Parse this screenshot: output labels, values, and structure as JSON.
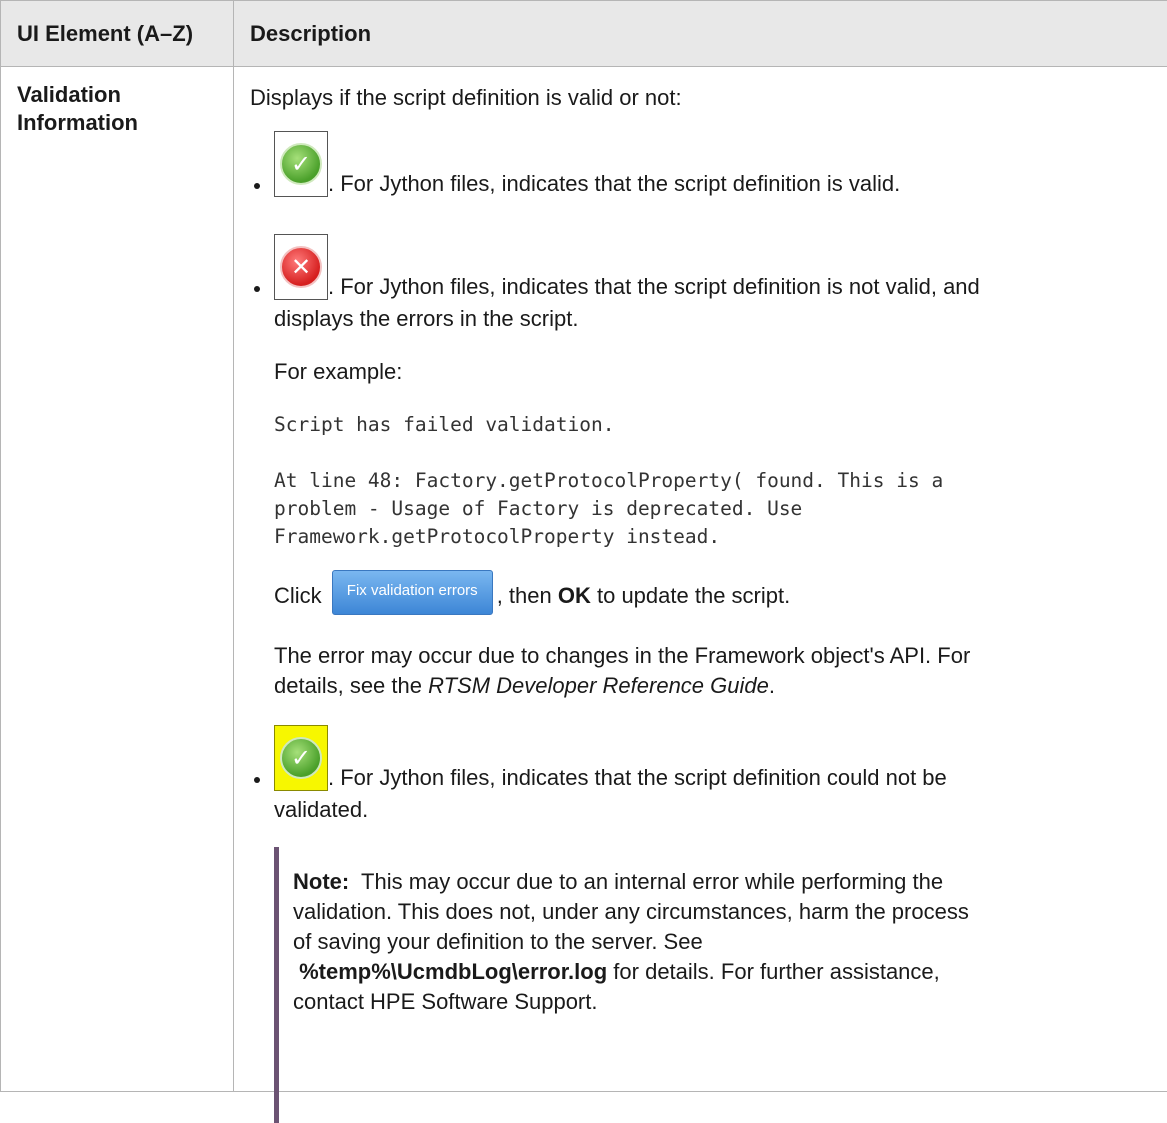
{
  "table": {
    "header": {
      "col1": "UI Element (A–Z)",
      "col2": "Description"
    },
    "row": {
      "element_line1": "Validation",
      "element_line2": "Information",
      "intro": "Displays if the script definition is valid or not:",
      "valid_item": {
        "icon": "green-check-icon",
        "text": ". For Jython files, indicates that the script definition is valid."
      },
      "invalid_item": {
        "icon": "red-x-icon",
        "text_line1": ". For Jython files, indicates that the script definition is not valid, and",
        "text_line2": "displays the errors in the script."
      },
      "example_label": "For example:",
      "code_line1": "Script has failed validation.",
      "code_line2": "At line 48: Factory.getProtocolProperty( found. This is a",
      "code_line3": "problem - Usage of Factory is deprecated. Use",
      "code_line4": "Framework.getProtocolProperty instead.",
      "click_prefix": "Click",
      "fix_button_label": "Fix validation errors",
      "click_mid": ", then",
      "click_bold": "OK",
      "click_suffix": "to update the script.",
      "error_line1": "The error may occur due to changes in the Framework object's API. For",
      "error_line2_prefix": "details, see the",
      "error_guide": "RTSM Developer Reference Guide",
      "error_line2_suffix": ".",
      "not_validated_item": {
        "icon": "green-check-yellow-bg-icon",
        "text_line1": ". For Jython files, indicates that the script definition could not be",
        "text_line2": "validated."
      },
      "note": {
        "label": "Note:",
        "line1": "This may occur due to an internal error while performing the",
        "line2": "validation. This does not, under any circumstances, harm the process",
        "line3": "of saving your definition to the server. See",
        "path": "%temp%\\UcmdbLog\\error.log",
        "line4_suffix": "for details. For further assistance,",
        "line5": "contact HPE Software Support."
      }
    }
  },
  "colors": {
    "header_bg": "#e8e8e8",
    "border": "#b5b5b5",
    "note_bar": "#6b5373",
    "button_blue": "#3d86d6"
  }
}
